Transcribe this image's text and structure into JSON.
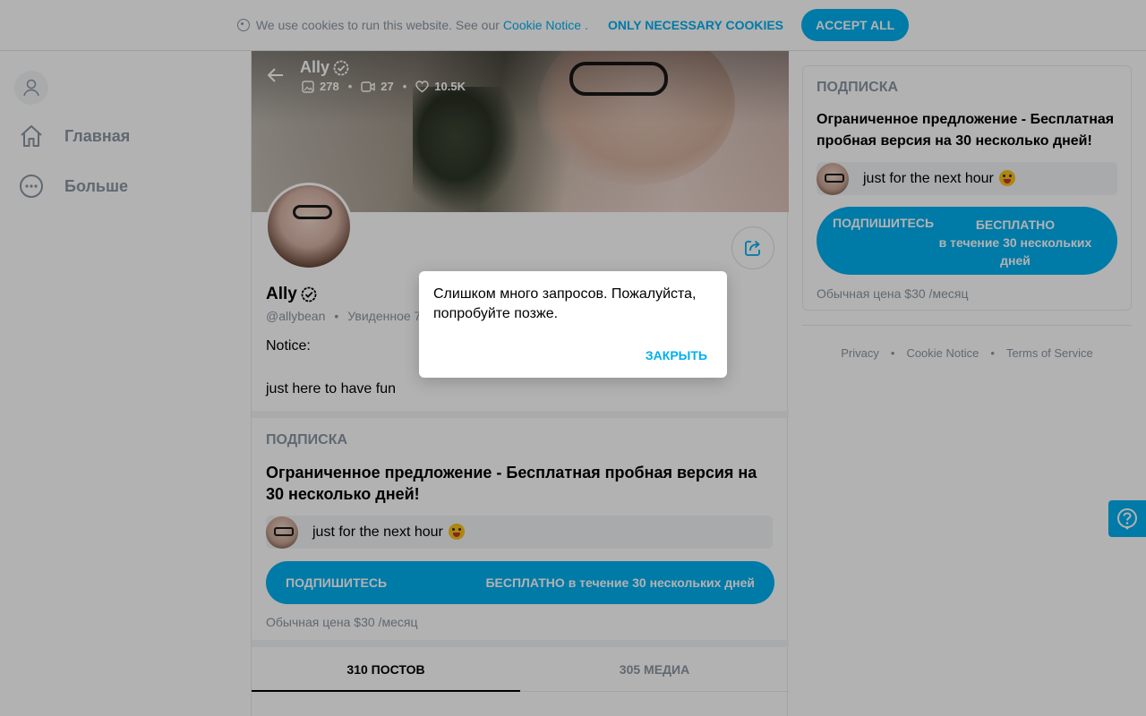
{
  "cookie_bar": {
    "text": "We use cookies to run this website. See our",
    "link": "Cookie Notice",
    "dot": ".",
    "necessary_label": "ONLY NECESSARY COOKIES",
    "accept_label": "ACCEPT ALL"
  },
  "nav": {
    "items": [
      {
        "label": "Главная",
        "icon": "home-icon"
      },
      {
        "label": "Больше",
        "icon": "more-icon"
      }
    ]
  },
  "profile": {
    "cover_name": "Ally",
    "stats": {
      "photos": "278",
      "videos": "27",
      "likes": "10.5K"
    },
    "name": "Ally",
    "handle": "@allybean",
    "seen": "Увиденное 7",
    "bio_notice": "Notice:",
    "bio_text": "just here to have fun"
  },
  "subscription": {
    "title": "ПОДПИСКА",
    "offer": "Ограниченное предложение - Бесплатная пробная версия на 30 несколько дней!",
    "message": "just for the next hour",
    "button_left": "ПОДПИШИТЕСЬ",
    "button_right": "БЕСПЛАТНО в течение 30 нескольких дней",
    "price": "Обычная цена $30 /месяц"
  },
  "tabs": [
    {
      "label": "310 ПОСТОВ",
      "active": true
    },
    {
      "label": "305 МЕДИА",
      "active": false
    }
  ],
  "right_card": {
    "title": "ПОДПИСКА",
    "offer": "Ограниченное предложение - Бесплатная пробная версия на 30 несколько дней!",
    "message": "just for the next hour",
    "button_left": "ПОДПИШИТЕСЬ",
    "button_right_line1": "БЕСПЛАТНО",
    "button_right_line2": "в течение 30 нескольких дней",
    "price": "Обычная цена $30 /месяц"
  },
  "footer": {
    "privacy": "Privacy",
    "cookie_notice": "Cookie Notice",
    "terms": "Terms of Service",
    "separator": "•"
  },
  "dialog": {
    "message": "Слишком много запросов. Пожалуйста, попробуйте позже.",
    "close_label": "ЗАКРЫТЬ"
  },
  "colors": {
    "accent": "#00aff0",
    "muted": "#8a96a3",
    "panel": "#f2f4f5"
  }
}
